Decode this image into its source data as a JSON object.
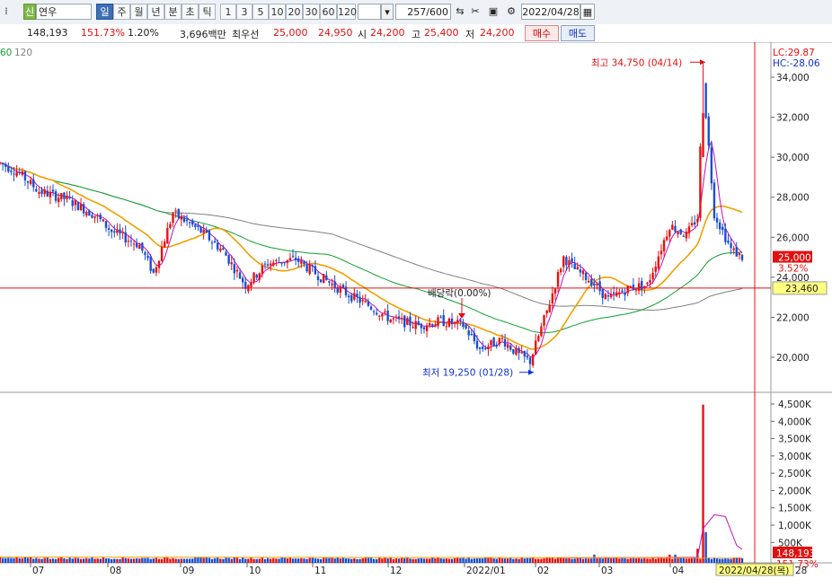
{
  "toolbar": {
    "stock_name": "연우",
    "credit_badge": "신",
    "periods": [
      "일",
      "주",
      "월",
      "년",
      "분",
      "초",
      "틱"
    ],
    "active_period": "일",
    "intervals": [
      "1",
      "3",
      "5",
      "10",
      "20",
      "30",
      "60",
      "120"
    ],
    "count": "257",
    "count_total": "/600",
    "date": "2022/04/28"
  },
  "quote": {
    "volume": "148,193",
    "volume_ratio": "151.73%",
    "turnover": "1.20%",
    "amount": "3,696백만",
    "best_ask_label": "최우선",
    "best_ask": "25,000",
    "best_bid": "24,950",
    "open_label": "시",
    "open": "24,200",
    "high_label": "고",
    "high": "25,400",
    "low_label": "저",
    "low": "24,200",
    "buy_label": "매수",
    "sell_label": "매도"
  },
  "chart_data": {
    "type": "candlestick",
    "ma_legend": [
      "60",
      "120"
    ],
    "price_axis": [
      "34,000",
      "32,000",
      "30,000",
      "28,000",
      "26,000",
      "24,000",
      "22,000",
      "20,000"
    ],
    "volume_axis": [
      "4,500K",
      "4,000K",
      "3,500K",
      "3,000K",
      "2,500K",
      "2,000K",
      "1,500K",
      "1,000K",
      "500K"
    ],
    "x_labels": [
      "07",
      "08",
      "09",
      "10",
      "11",
      "12",
      "2022/01",
      "02",
      "03",
      "04"
    ],
    "lc": "LC:29.87",
    "hc": "HC:-28.06",
    "high_annotation": "최고 34,750 (04/14)",
    "low_annotation": "최저 19,250 (01/28)",
    "dividend_annotation": "배당락(0.00%)",
    "current_price": "25,000",
    "current_change": "3.52%",
    "crosshair_price": "23,460",
    "volume_current": "148,193",
    "volume_ratio": "151.73%",
    "date_tag": "2022/04/28(목)",
    "date_tag_suffix": "28",
    "ylim": [
      18000,
      35500
    ],
    "colors": {
      "up": "#e81010",
      "down": "#1a4fd0",
      "ma5": "#c010c0",
      "ma20": "#f0a000",
      "ma60": "#10a030",
      "ma120": "#808080"
    }
  }
}
